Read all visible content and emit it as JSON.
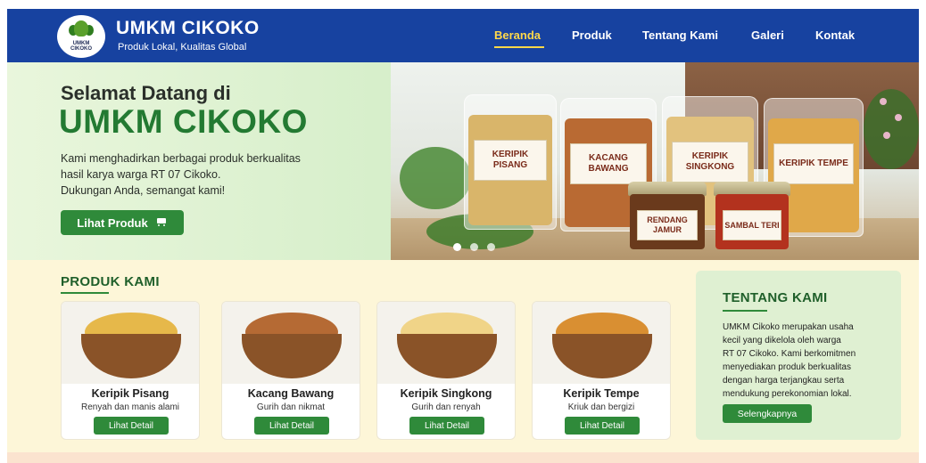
{
  "brand": {
    "logo_text_1": "UMKM",
    "logo_text_2": "CIKOKO",
    "title": "UMKM CIKOKO",
    "tagline": "Produk Lokal, Kualitas Global"
  },
  "nav": {
    "items": [
      {
        "label": "Beranda",
        "active": true
      },
      {
        "label": "Produk",
        "active": false
      },
      {
        "label": "Tentang Kami",
        "active": false
      },
      {
        "label": "Galeri",
        "active": false
      },
      {
        "label": "Kontak",
        "active": false
      }
    ]
  },
  "hero": {
    "greeting": "Selamat Datang di",
    "title": "UMKM CIKOKO",
    "lines": [
      "Kami menghadirkan berbagai produk berkualitas",
      "hasil karya warga RT 07 Cikoko.",
      "Dukungan Anda, semangat kami!"
    ],
    "button_label": "Lihat Produk",
    "button_icon": "cart-icon",
    "slides": 3,
    "active_slide": 1,
    "photo_labels": {
      "bag1": "KERIPIK PISANG",
      "bag2": "KACANG BAWANG",
      "bag3": "KERIPIK SINGKONG",
      "bag4": "KERIPIK TEMPE",
      "jar1": "RENDANG JAMUR",
      "jar2": "SAMBAL TERI"
    }
  },
  "products": {
    "section_title": "PRODUK KAMI",
    "items": [
      {
        "name": "Keripik Pisang",
        "desc": "Renyah dan manis alami",
        "button": "Lihat Detail"
      },
      {
        "name": "Kacang Bawang",
        "desc": "Gurih dan nikmat",
        "button": "Lihat Detail"
      },
      {
        "name": "Keripik Singkong",
        "desc": "Gurih dan renyah",
        "button": "Lihat Detail"
      },
      {
        "name": "Keripik Tempe",
        "desc": "Kriuk dan bergizi",
        "button": "Lihat Detail"
      }
    ]
  },
  "about": {
    "title": "TENTANG KAMI",
    "lines": [
      "UMKM Cikoko merupakan usaha",
      "kecil yang dikelola oleh warga",
      "RT 07 Cikoko. Kami berkomitmen",
      "menyediakan produk berkualitas",
      "dengan harga terjangkau serta",
      "mendukung perekonomian lokal."
    ],
    "button_label": "Selengkapnya"
  },
  "colors": {
    "nav_bg": "#1742a0",
    "accent_green": "#2f8a3a",
    "active_nav": "#ffd84a",
    "page_bg": "#fdf6d8"
  }
}
